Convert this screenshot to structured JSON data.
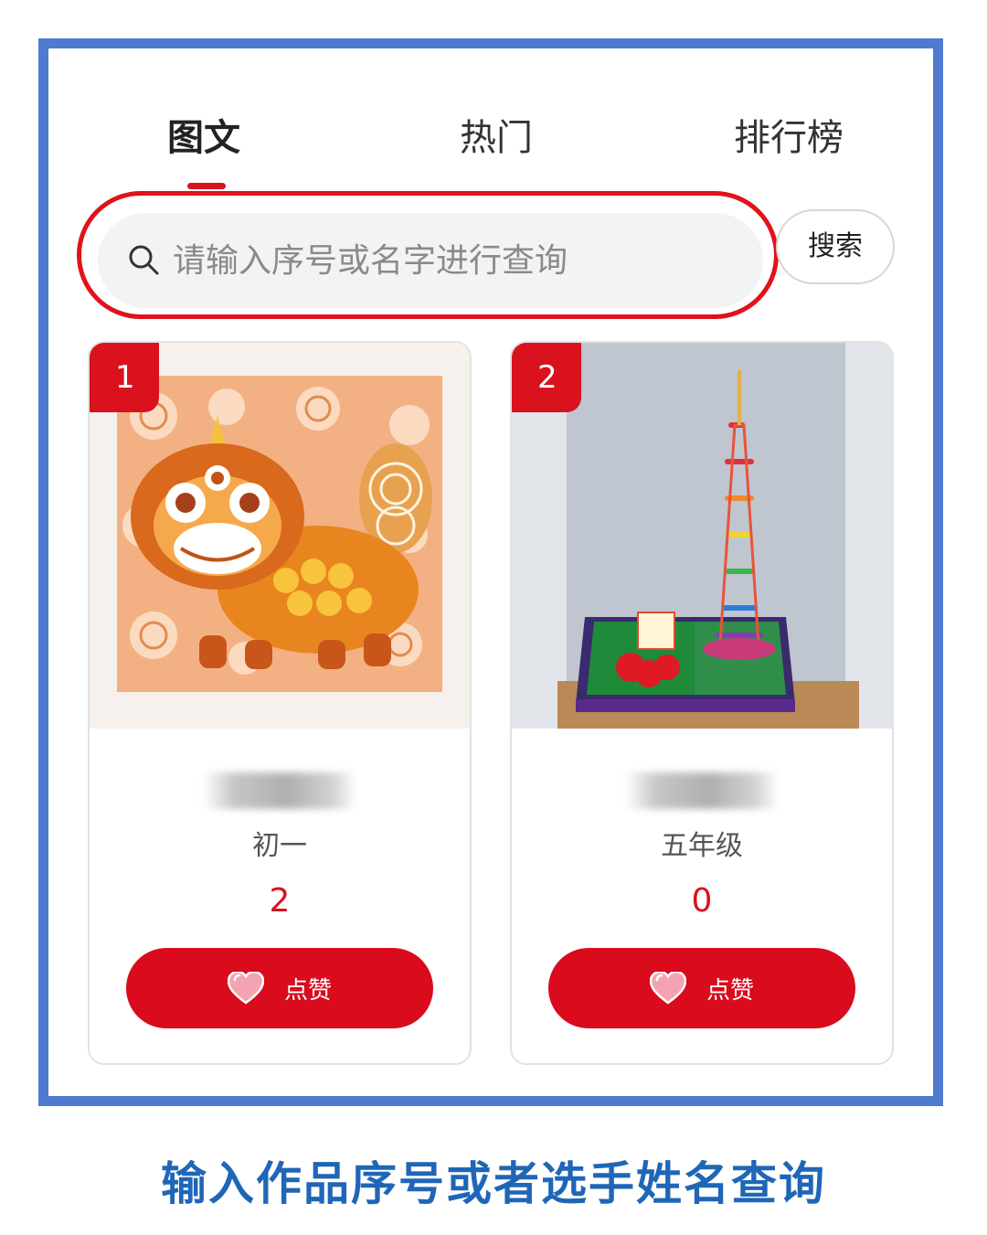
{
  "tabs": [
    {
      "label": "图文",
      "active": true
    },
    {
      "label": "热门",
      "active": false
    },
    {
      "label": "排行榜",
      "active": false
    }
  ],
  "search": {
    "placeholder": "请输入序号或名字进行查询",
    "button_label": "搜索"
  },
  "cards": [
    {
      "rank": "1",
      "grade": "初一",
      "votes": "2",
      "vote_label": "点赞",
      "image": "paper-cut-lion"
    },
    {
      "rank": "2",
      "grade": "五年级",
      "votes": "0",
      "vote_label": "点赞",
      "image": "canton-tower-model"
    }
  ],
  "caption": "输入作品序号或者选手姓名查询",
  "colors": {
    "accent": "#d9121e",
    "frame": "#4f7ad0",
    "caption": "#1f66b7"
  }
}
